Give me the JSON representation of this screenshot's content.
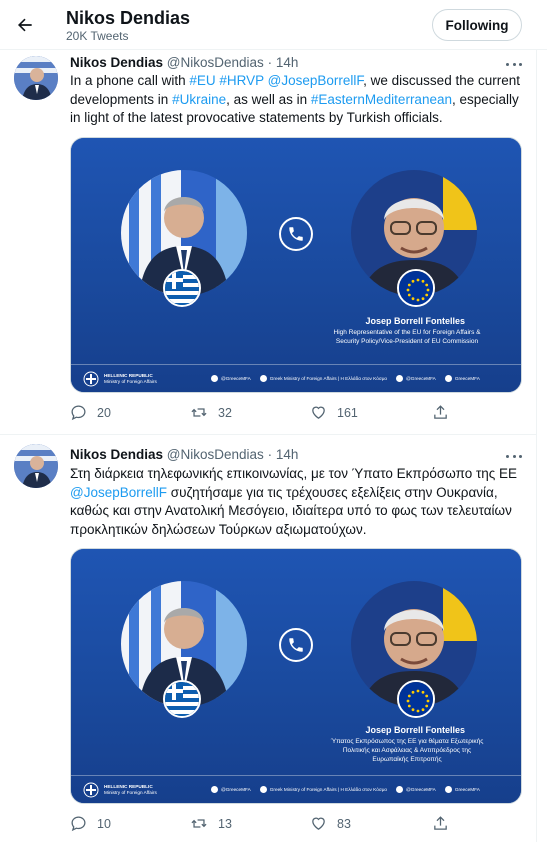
{
  "header": {
    "title": "Nikos Dendias",
    "tweet_count": "20K Tweets",
    "follow_label": "Following"
  },
  "colors": {
    "link": "#1d9bf0",
    "card_blue": "#1b4aa0",
    "text_secondary": "#536471"
  },
  "tweets": [
    {
      "name": "Nikos Dendias",
      "handle": "@NikosDendias",
      "dot": "·",
      "time": "14h",
      "text": {
        "t1": "In a phone call with ",
        "l1": "#EU",
        "t2": " ",
        "l2": "#HRVP",
        "t3": " ",
        "l3": "@JosepBorrellF",
        "t4": ", we discussed the current developments in ",
        "l4": "#Ukraine",
        "t5": ", as well as in ",
        "l5": "#EasternMediterranean",
        "t6": ", especially in light of the latest provocative statements by Turkish officials."
      },
      "card": {
        "caption_name": "Josep Borrell Fontelles",
        "caption_role_1": "High Representative of the EU for Foreign Affairs &",
        "caption_role_2": "Security Policy/Vice-President of EU Commission",
        "caption_role_3": "",
        "ministry_1": "HELLENIC REPUBLIC",
        "ministry_2": "Ministry of Foreign Affairs",
        "social_1": "@GreeceMFA",
        "social_2": "Greek Ministry of Foreign Affairs | Η Ελλάδα στον Κόσμο",
        "social_3": "@GreeceMFA",
        "social_4": "GreeceMFA"
      },
      "replies": "20",
      "retweets": "32",
      "likes": "161"
    },
    {
      "name": "Nikos Dendias",
      "handle": "@NikosDendias",
      "dot": "·",
      "time": "14h",
      "text": {
        "t1": "Στη διάρκεια τηλεφωνικής επικοινωνίας, με τον Ύπατο Εκπρόσωπο της ΕΕ ",
        "l1": "@JosepBorrellF",
        "t2": " συζητήσαμε για τις τρέχουσες εξελίξεις στην Ουκρανία, καθώς και στην Ανατολική Μεσόγειο, ιδιαίτερα υπό το φως των τελευταίων προκλητικών δηλώσεων Τούρκων αξιωματούχων."
      },
      "card": {
        "caption_name": "Josep Borrell Fontelles",
        "caption_role_1": "Ύπατος Εκπρόσωπος της ΕΕ για θέματα Εξωτερικής",
        "caption_role_2": "Πολιτικής και Ασφάλειας & Αντιπρόεδρος της",
        "caption_role_3": "Ευρωπαϊκής Επιτροπής",
        "ministry_1": "HELLENIC REPUBLIC",
        "ministry_2": "Ministry of Foreign Affairs",
        "social_1": "@GreeceMFA",
        "social_2": "Greek Ministry of Foreign Affairs | Η Ελλάδα στον Κόσμο",
        "social_3": "@GreeceMFA",
        "social_4": "GreeceMFA"
      },
      "replies": "10",
      "retweets": "13",
      "likes": "83"
    }
  ]
}
